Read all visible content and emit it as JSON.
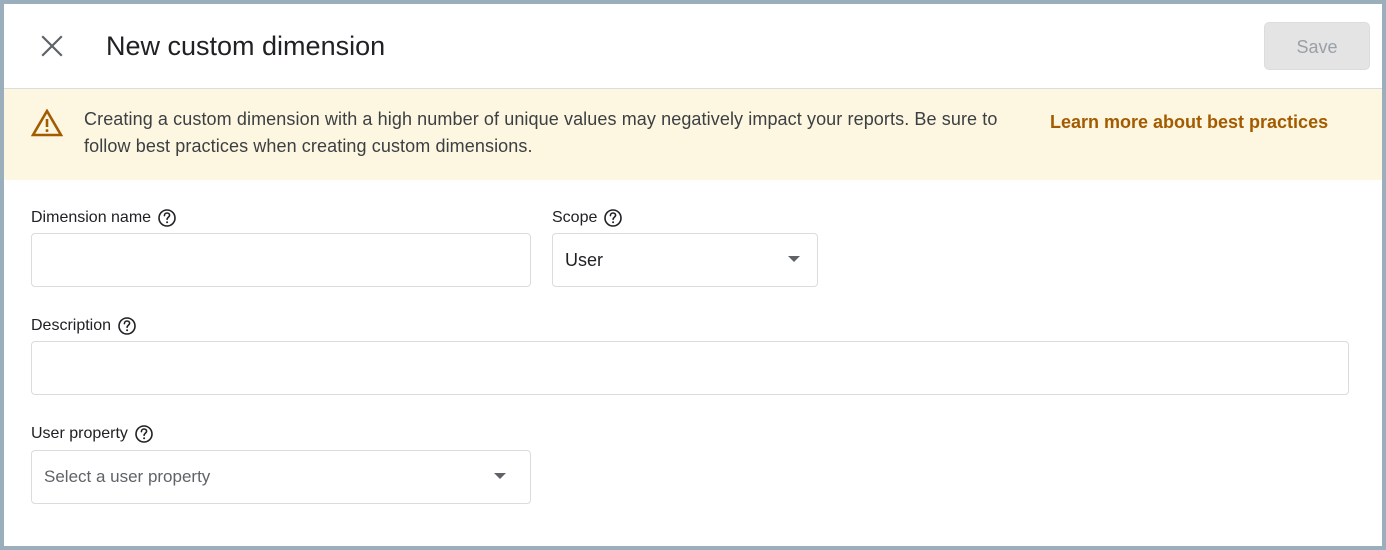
{
  "header": {
    "title": "New custom dimension",
    "save_label": "Save"
  },
  "banner": {
    "message": "Creating a custom dimension with a high number of unique values may negatively impact your reports. Be sure to follow best practices when creating custom dimensions.",
    "link_label": "Learn more about best practices"
  },
  "form": {
    "dimension_name": {
      "label": "Dimension name",
      "value": ""
    },
    "scope": {
      "label": "Scope",
      "value": "User"
    },
    "description": {
      "label": "Description",
      "value": ""
    },
    "user_property": {
      "label": "User property",
      "placeholder": "Select a user property"
    }
  },
  "colors": {
    "banner_bg": "#fdf6e0",
    "warning": "#a35b00",
    "link": "#a35b00"
  },
  "icons": [
    "close-icon",
    "warning-icon",
    "help-icon",
    "dropdown-arrow-icon"
  ]
}
